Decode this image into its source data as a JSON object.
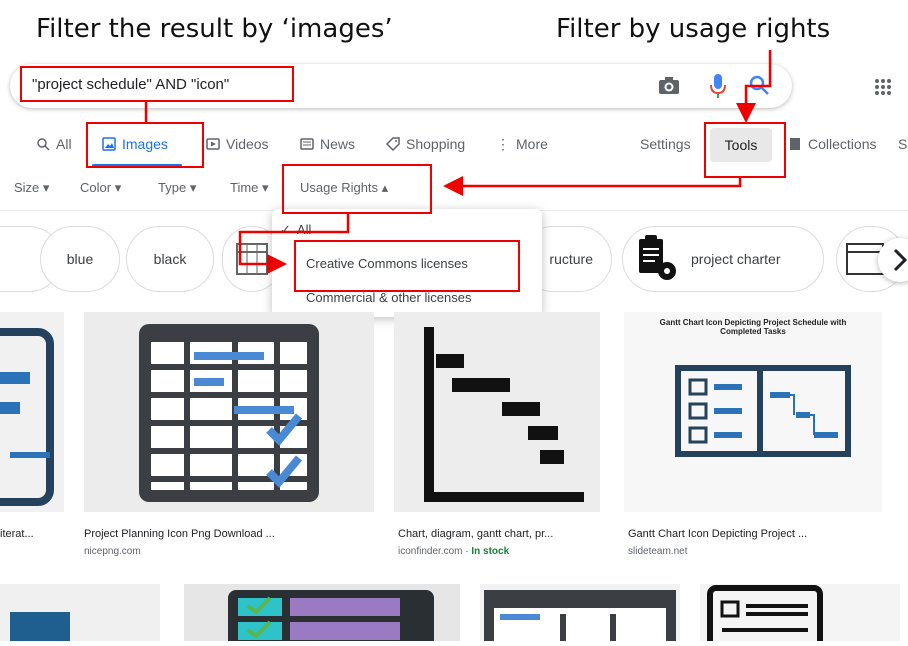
{
  "annotations": {
    "left": "Filter the result by ‘images’",
    "right": "Filter by usage rights"
  },
  "search": {
    "query": "\"project schedule\" AND \"icon\""
  },
  "tabs": {
    "all": "All",
    "images": "Images",
    "videos": "Videos",
    "news": "News",
    "shopping": "Shopping",
    "more": "More",
    "settings": "Settings",
    "tools": "Tools",
    "collections": "Collections",
    "safesearch": "S"
  },
  "filters": {
    "size": "Size",
    "color": "Color",
    "type": "Type",
    "time": "Time",
    "usage_rights": "Usage Rights"
  },
  "usage_menu": {
    "all": "All",
    "creative_commons": "Creative Commons licenses",
    "commercial": "Commercial & other licenses"
  },
  "chips": {
    "blue": "blue",
    "black": "black",
    "structure": "ructure",
    "charter": "project charter"
  },
  "results": [
    {
      "caption": "iterat...",
      "source": ""
    },
    {
      "caption": "Project Planning Icon Png Download ...",
      "source": "nicepng.com"
    },
    {
      "caption": "Chart, diagram, gantt chart, pr...",
      "source": "iconfinder.com · ",
      "stock": "In stock"
    },
    {
      "caption": "Gantt Chart Icon Depicting Project ...",
      "source": "slideteam.net",
      "inner_title": "Gantt Chart Icon Depicting Project Schedule with Completed Tasks"
    }
  ],
  "colors": {
    "accent": "#1a73e8",
    "annotation_red": "#e00000",
    "in_stock": "#188038"
  }
}
